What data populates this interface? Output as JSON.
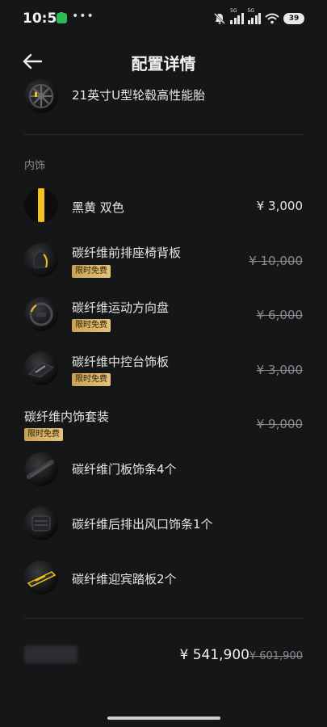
{
  "status_bar": {
    "time": "10:51",
    "battery": "39",
    "signal_labels": [
      "5G",
      "5G"
    ],
    "icons": [
      "wechat-icon",
      "more-dots-icon",
      "mute-icon",
      "signal-5g-icon",
      "wifi-icon",
      "battery-icon"
    ]
  },
  "header": {
    "title": "配置详情",
    "back_icon": "arrow-left-icon"
  },
  "wheel_item": {
    "label": "21英寸U型轮毂高性能胎"
  },
  "interior": {
    "section_title": "内饰",
    "items": [
      {
        "label": "黑黄 双色",
        "price": "¥ 3,000",
        "struck": false,
        "badge": ""
      },
      {
        "label": "碳纤维前排座椅背板",
        "price": "¥ 10,000",
        "struck": true,
        "badge": "限时免费"
      },
      {
        "label": "碳纤维运动方向盘",
        "price": "¥ 6,000",
        "struck": true,
        "badge": "限时免费"
      },
      {
        "label": "碳纤维中控台饰板",
        "price": "¥ 3,000",
        "struck": true,
        "badge": "限时免费"
      }
    ],
    "package": {
      "title": "碳纤维内饰套装",
      "badge": "限时免费",
      "price": "¥ 9,000",
      "items": [
        {
          "label": "碳纤维门板饰条4个"
        },
        {
          "label": "碳纤维后排出风口饰条1个"
        },
        {
          "label": "碳纤维迎宾踏板2个"
        }
      ]
    }
  },
  "footer": {
    "total": "¥ 541,900",
    "original_total": "¥ 601,900"
  },
  "colors": {
    "background": "#151618",
    "accent_gold": "#d4b063",
    "accent_yellow": "#f2c318",
    "text_primary": "#e6e6e6",
    "text_muted": "#8a8b8e"
  }
}
